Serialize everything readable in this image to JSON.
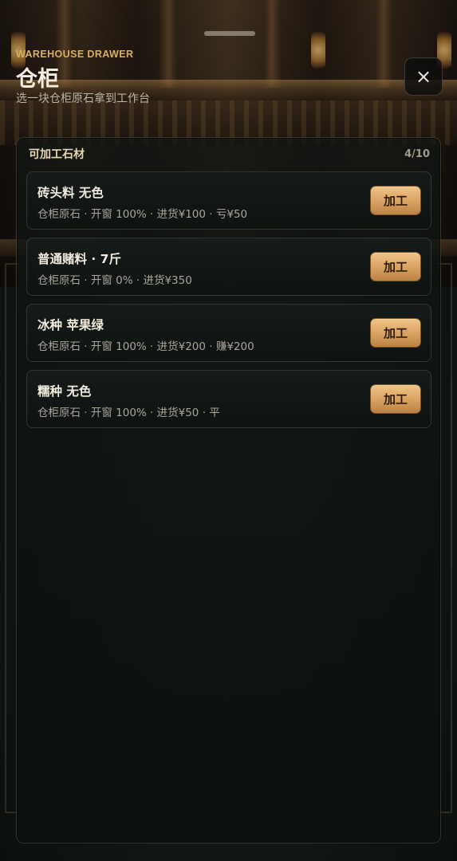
{
  "drawer": {
    "eyebrow": "WAREHOUSE DRAWER",
    "title": "仓柜",
    "subtitle": "选一块仓柜原石拿到工作台",
    "close_icon": "×"
  },
  "panel": {
    "title": "可加工石材",
    "count": "4/10"
  },
  "items": [
    {
      "name": "砖头料 无色",
      "desc": "仓柜原石 · 开窗 100% · 进货¥100 · 亏¥50",
      "action": "加工"
    },
    {
      "name": "普通赌料 · 7斤",
      "desc": "仓柜原石 · 开窗 0% · 进货¥350",
      "action": "加工"
    },
    {
      "name": "冰种 苹果绿",
      "desc": "仓柜原石 · 开窗 100% · 进货¥200 · 赚¥200",
      "action": "加工"
    },
    {
      "name": "糯种 无色",
      "desc": "仓柜原石 · 开窗 100% · 进货¥50 · 平",
      "action": "加工"
    }
  ],
  "colors": {
    "accent": "#d8b062",
    "button": "#d9a15e",
    "background": "#121916"
  }
}
